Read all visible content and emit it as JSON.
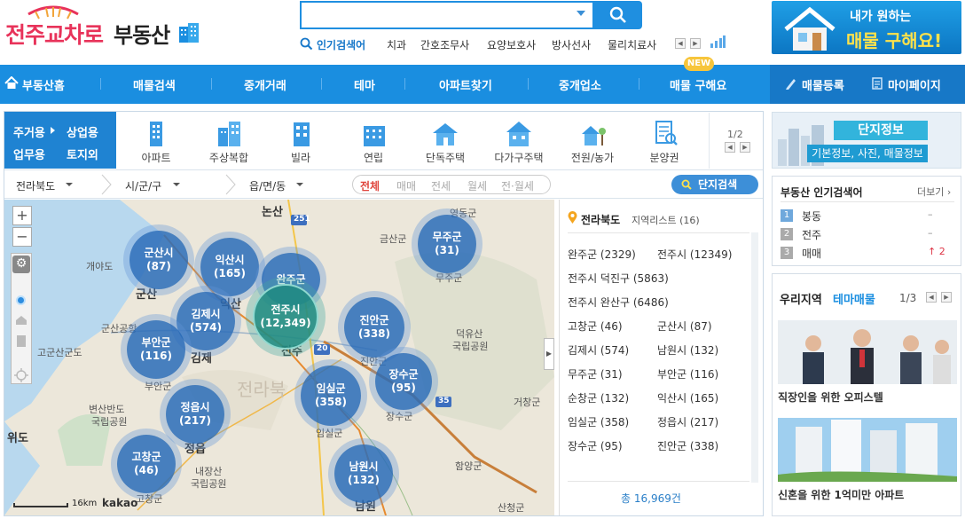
{
  "header": {
    "logo_main": "전주교차로",
    "logo_sub": "부동산",
    "search_placeholder": "",
    "popular_label": "인기검색어",
    "popular_keywords": [
      "치과",
      "간호조무사",
      "요양보호사",
      "방사선사",
      "물리치료사"
    ],
    "banner_line1": "내가 원하는",
    "banner_line2": "매물 구해요!"
  },
  "nav": {
    "items": [
      "부동산홈",
      "매물검색",
      "중개거래",
      "테마",
      "아파트찾기",
      "중개업소",
      "매물 구해요"
    ],
    "new_badge": "NEW",
    "right_items": [
      "매물등록",
      "마이페이지"
    ]
  },
  "categories": {
    "left": [
      "주거용",
      "상업용",
      "업무용",
      "토지외"
    ],
    "types": [
      "아파트",
      "주상복합",
      "빌라",
      "연립",
      "단독주택",
      "다가구주택",
      "전원/농가",
      "분양권"
    ],
    "page": "1/2"
  },
  "filters": {
    "region1": "전라북도",
    "region2": "시/군/구",
    "region3": "읍/면/동",
    "deal_types": [
      "전체",
      "매매",
      "전세",
      "월세",
      "전·월세"
    ],
    "complex_search": "단지검색"
  },
  "map": {
    "clusters": [
      {
        "name": "군산시",
        "count": "(87)"
      },
      {
        "name": "익산시",
        "count": "(165)"
      },
      {
        "name": "완주군",
        "count": ""
      },
      {
        "name": "무주군",
        "count": "(31)"
      },
      {
        "name": "김제시",
        "count": "(574)"
      },
      {
        "name": "전주시",
        "count": "(12,349)"
      },
      {
        "name": "진안군",
        "count": "(338)"
      },
      {
        "name": "부안군",
        "count": "(116)"
      },
      {
        "name": "장수군",
        "count": "(95)"
      },
      {
        "name": "임실군",
        "count": "(358)"
      },
      {
        "name": "정읍시",
        "count": "(217)"
      },
      {
        "name": "고창군",
        "count": "(46)"
      },
      {
        "name": "남원시",
        "count": "(132)"
      }
    ],
    "places": [
      "논산",
      "영동군",
      "금산군",
      "무주군",
      "개야도",
      "군산",
      "익산",
      "군산공항",
      "고군산군도",
      "김제",
      "부안군",
      "덕유산",
      "국립공원",
      "진안군",
      "전라북",
      "변산반도",
      "국립공원",
      "위도",
      "정읍",
      "내장산",
      "국립공원",
      "거창군",
      "장수군",
      "임실군",
      "함양군",
      "남원",
      "고창군",
      "산청군",
      "전주"
    ],
    "road_labels": [
      "251",
      "20",
      "35"
    ],
    "scale": "16km",
    "brand": "kakao"
  },
  "list": {
    "region": "전라북도",
    "title_suffix": "지역리스트",
    "count": "(16)",
    "rows": [
      [
        "완주군 (2329)",
        "전주시 (12349)"
      ],
      [
        "전주시 덕진구 (5863)"
      ],
      [
        "전주시 완산구 (6486)"
      ],
      [
        "고창군 (46)",
        "군산시 (87)"
      ],
      [
        "김제시 (574)",
        "남원시 (132)"
      ],
      [
        "무주군 (31)",
        "부안군 (116)"
      ],
      [
        "순창군 (132)",
        "익산시 (165)"
      ],
      [
        "임실군 (358)",
        "정읍시 (217)"
      ],
      [
        "장수군 (95)",
        "진안군 (338)"
      ]
    ],
    "total": "총 16,969건"
  },
  "sidebar": {
    "complex_title": "단지정보",
    "complex_sub": "기본정보, 사진, 매물정보",
    "popular_title": "부동산 인기검색어",
    "popular_more": "더보기",
    "ranks": [
      {
        "rank": "1",
        "label": "봉동",
        "mark": "–"
      },
      {
        "rank": "2",
        "label": "전주",
        "mark": "–"
      },
      {
        "rank": "3",
        "label": "매매",
        "mark": "↑ 2"
      }
    ],
    "theme_title": "우리지역",
    "theme_hl": "테마매물",
    "theme_page": "1/3",
    "theme_items": [
      "직장인을 위한 오피스텔",
      "신혼을 위한 1억미만 아파트"
    ]
  },
  "colors": {
    "primary": "#1a8ee0",
    "cluster": "#2a6cb8",
    "logo": "#e8335a"
  }
}
